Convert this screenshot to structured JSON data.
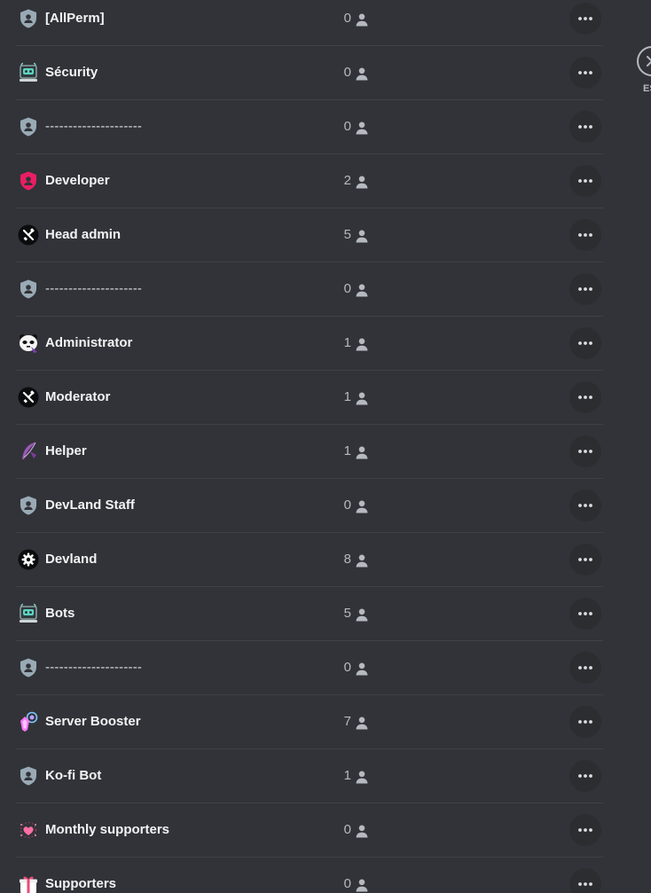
{
  "roles": [
    {
      "name": "[AllPerm]",
      "count": "0",
      "icon": "shield-user-icon"
    },
    {
      "name": "Sécurity",
      "count": "0",
      "icon": "robot-icon"
    },
    {
      "name": "---------------------",
      "count": "0",
      "icon": "shield-user-icon"
    },
    {
      "name": "Developer",
      "count": "2",
      "icon": "shield-user-icon"
    },
    {
      "name": "Head admin",
      "count": "5",
      "icon": "tools-icon"
    },
    {
      "name": "---------------------",
      "count": "0",
      "icon": "shield-user-icon"
    },
    {
      "name": "Administrator",
      "count": "1",
      "icon": "panda-icon"
    },
    {
      "name": "Moderator",
      "count": "1",
      "icon": "tools-icon"
    },
    {
      "name": "Helper",
      "count": "1",
      "icon": "feather-icon"
    },
    {
      "name": "DevLand Staff",
      "count": "0",
      "icon": "shield-user-icon"
    },
    {
      "name": "Devland",
      "count": "8",
      "icon": "gear-icon"
    },
    {
      "name": "Bots",
      "count": "5",
      "icon": "robot-icon"
    },
    {
      "name": "---------------------",
      "count": "0",
      "icon": "shield-user-icon"
    },
    {
      "name": "Server Booster",
      "count": "7",
      "icon": "booster-gem-icon"
    },
    {
      "name": "Ko-fi Bot",
      "count": "1",
      "icon": "shield-user-icon"
    },
    {
      "name": "Monthly supporters",
      "count": "0",
      "icon": "heart-sparkle-icon"
    },
    {
      "name": "Supporters",
      "count": "0",
      "icon": "gift-icon"
    }
  ],
  "side_panel": {
    "close_icon": "close-icon",
    "esc_label": "ESC"
  },
  "colors": {
    "background": "#313338",
    "row_divider": "#3f4147",
    "more_button_bg": "#2b2d31",
    "text_primary": "#f2f3f5",
    "text_muted": "#b5bac1",
    "default_role_shield": "#99aab5",
    "developer_role": "#e91e63"
  }
}
